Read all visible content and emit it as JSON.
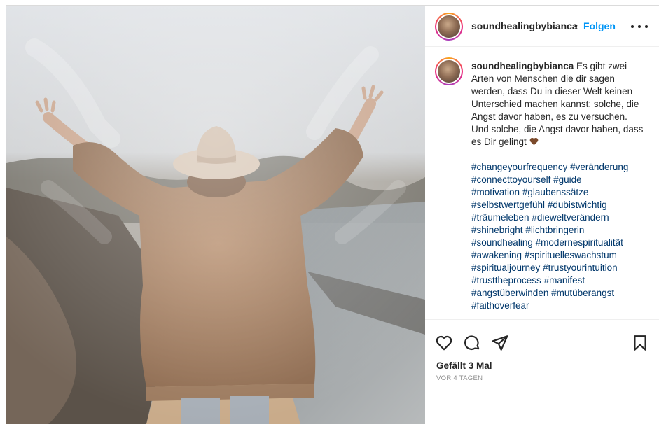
{
  "post": {
    "author": "soundhealingbybianca",
    "follow_label": "Folgen",
    "separator": "•",
    "caption_text": "Es gibt zwei Arten von Menschen die dir sagen werden, dass Du in dieser Welt keinen Unterschied machen kannst: solche, die Angst davor haben, es zu versuchen. Und solche, die Angst davor haben, dass es Dir gelingt",
    "hashtags": [
      "#changeyourfrequency",
      "#veränderung",
      "#connecttoyourself",
      "#guide",
      "#motivation",
      "#glaubenssätze",
      "#selbstwertgefühl",
      "#dubistwichtig",
      "#träumeleben",
      "#dieweltverändern",
      "#shinebright",
      "#lichtbringerin",
      "#soundhealing",
      "#modernespiritualität",
      "#awakening",
      "#spirituelleswachstum",
      "#spiritualjourney",
      "#trustyourintuition",
      "#trusttheprocess",
      "#manifest",
      "#angstüberwinden",
      "#mutüberangst",
      "#faithoverfear"
    ],
    "likes_text": "Gefällt 3 Mal",
    "time_text": "VOR 4 TAGEN"
  },
  "icons": {
    "like": "heart-outline-icon",
    "comment": "comment-bubble-icon",
    "share": "paper-plane-icon",
    "save": "bookmark-icon",
    "more": "more-horizontal-icon",
    "caption_emoji": "brown-heart-emoji"
  },
  "colors": {
    "link_blue": "#0095f6",
    "hashtag": "#00376b",
    "text": "#262626",
    "muted": "#8e8e8e",
    "border": "#dbdbdb"
  }
}
